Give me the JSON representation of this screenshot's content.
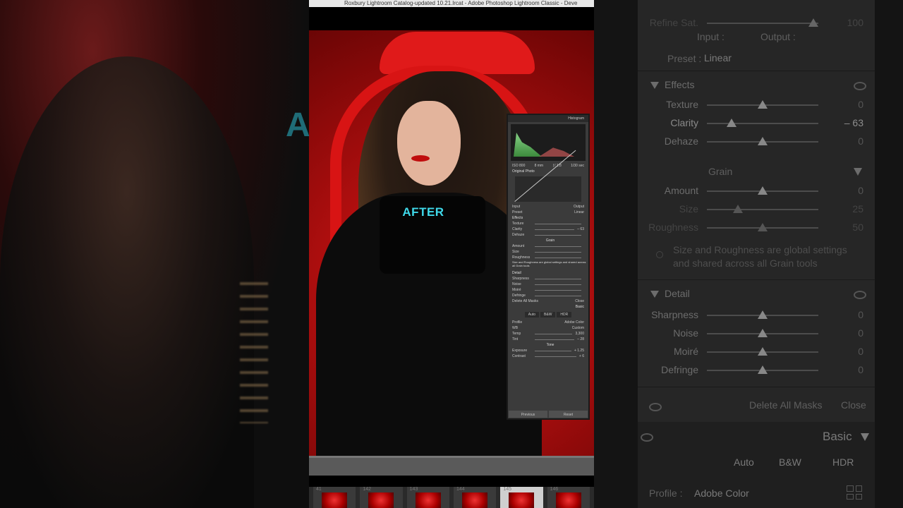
{
  "window": {
    "title": "Roxbury Lightroom Catalog-updated 10.21.lrcat - Adobe Photoshop Lightroom Classic - Deve"
  },
  "overlay": {
    "after_label": "AFTER",
    "ghost_text": "A"
  },
  "filmstrip": {
    "items": [
      {
        "num": "41"
      },
      {
        "num": "142"
      },
      {
        "num": "143"
      },
      {
        "num": "144"
      },
      {
        "num": "145"
      },
      {
        "num": "146"
      }
    ]
  },
  "mini_panel": {
    "histogram_label": "Histogram",
    "hist_readouts": [
      "ISO 800",
      "8 mm",
      "ƒ/ 1.8",
      "1/30 sec"
    ],
    "original_photo": "Original Photo",
    "curve_input": "Input",
    "curve_output": "Output",
    "preset_label": "Preset",
    "preset_value": "Linear",
    "effects_label": "Effects",
    "texture": "Texture",
    "clarity": "Clarity",
    "clarity_val": "– 63",
    "dehaze": "Dehaze",
    "grain": "Grain",
    "amount": "Amount",
    "size": "Size",
    "roughness": "Roughness",
    "grain_note": "Size and Roughness are global settings and shared across all Grain tools",
    "detail_label": "Detail",
    "sharpness": "Sharpness",
    "noise": "Noise",
    "moire": "Moiré",
    "defringe": "Defringe",
    "delete_masks": "Delete All Masks",
    "close": "Close",
    "basic_label": "Basic",
    "auto": "Auto",
    "bw": "B&W",
    "hdr": "HDR",
    "profile_label": "Profile",
    "profile_value": "Adobe Color",
    "wb_label": "WB",
    "wb_value": "Custom",
    "temp_label": "Temp",
    "temp_val": "3,300",
    "tint_label": "Tint",
    "tint_val": "– 28",
    "tone_label": "Tone",
    "exposure_label": "Exposure",
    "exposure_val": "+ 1.25",
    "contrast_label": "Contrast",
    "contrast_val": "+ 6",
    "previous": "Previous",
    "reset": "Reset"
  },
  "right_panel": {
    "refine_sat": "Refine Sat.",
    "refine_val": "100",
    "input": "Input :",
    "output": "Output :",
    "preset_label": "Preset :",
    "preset_value": "Linear",
    "effects": "Effects",
    "sliders_effects": [
      {
        "label": "Texture",
        "value": "0",
        "pos": 0.5
      },
      {
        "label": "Clarity",
        "value": "– 63",
        "pos": 0.22
      },
      {
        "label": "Dehaze",
        "value": "0",
        "pos": 0.5
      }
    ],
    "grain": "Grain",
    "sliders_grain": [
      {
        "label": "Amount",
        "value": "0",
        "pos": 0.5
      },
      {
        "label": "Size",
        "value": "25",
        "pos": 0.28
      },
      {
        "label": "Roughness",
        "value": "50",
        "pos": 0.5
      }
    ],
    "grain_note": "Size and Roughness are global settings and shared across all Grain tools",
    "detail": "Detail",
    "sliders_detail": [
      {
        "label": "Sharpness",
        "value": "0",
        "pos": 0.5
      },
      {
        "label": "Noise",
        "value": "0",
        "pos": 0.5
      },
      {
        "label": "Moiré",
        "value": "0",
        "pos": 0.5
      },
      {
        "label": "Defringe",
        "value": "0",
        "pos": 0.5
      }
    ],
    "delete_all_masks": "Delete All Masks",
    "close": "Close",
    "basic": "Basic",
    "auto": "Auto",
    "bw": "B&W",
    "hdr": "HDR",
    "profile_label": "Profile :",
    "profile_value": "Adobe Color"
  }
}
